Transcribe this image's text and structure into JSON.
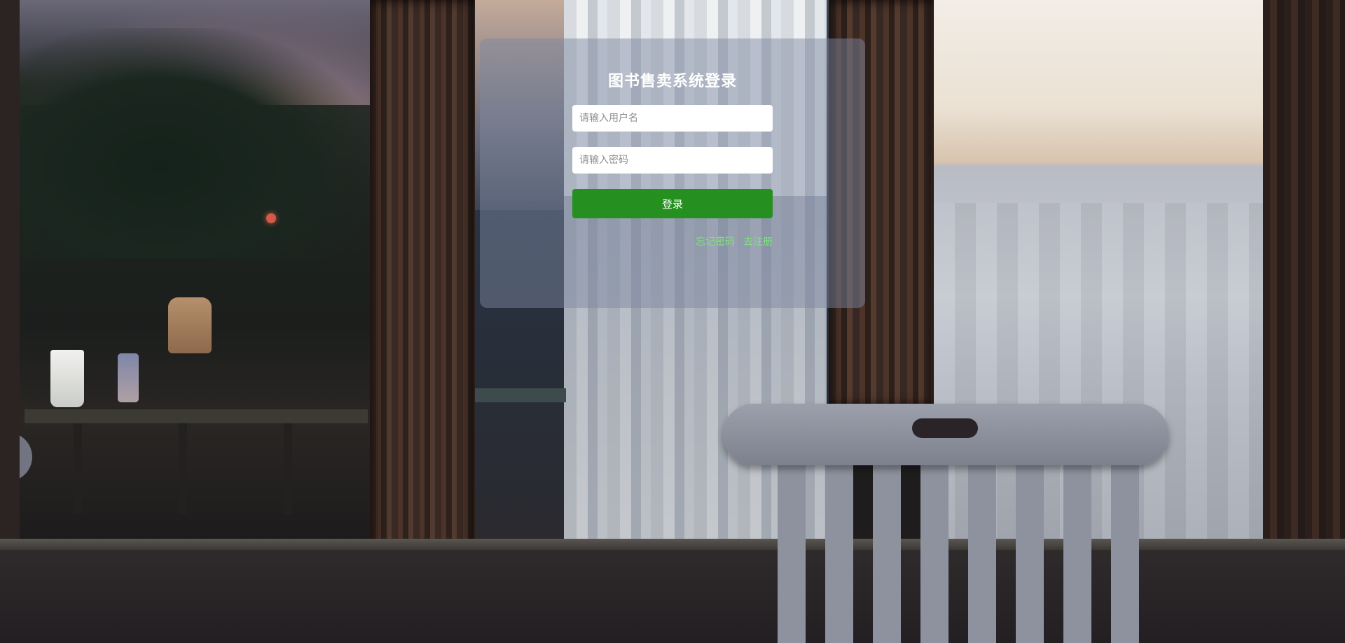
{
  "login": {
    "title": "图书售卖系统登录",
    "username_placeholder": "请输入用户名",
    "username_value": "",
    "password_placeholder": "请输入密码",
    "password_value": "",
    "submit_label": "登录",
    "forgot_password_label": "忘记密码",
    "register_label": "去注册"
  },
  "colors": {
    "primary_button": "#25901f",
    "link": "#7ee67a",
    "card_overlay": "rgba(125,135,160,0.48)"
  }
}
